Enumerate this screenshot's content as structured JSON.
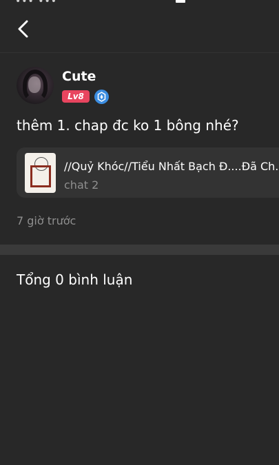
{
  "nav": {
    "back_icon": "chevron-left-icon"
  },
  "author": {
    "name": "Cute",
    "level": "Lv8",
    "verify_icon": "verified-badge-icon",
    "level_color": "#e8455f",
    "verify_color": "#3b8de0"
  },
  "post": {
    "text": "thêm 1. chap đc ko 1 bông nhé?",
    "linked": {
      "title": "//Quỷ Khóc//Tiểu Nhất Bạch Đ....Đã Ch...",
      "subtitle": "chat 2"
    },
    "timestamp": "7 giờ trước"
  },
  "comments": {
    "summary": "Tổng 0 bình luận"
  },
  "theme": {
    "background": "#282828",
    "card": "#333333",
    "muted_text": "#8f8f8f"
  }
}
